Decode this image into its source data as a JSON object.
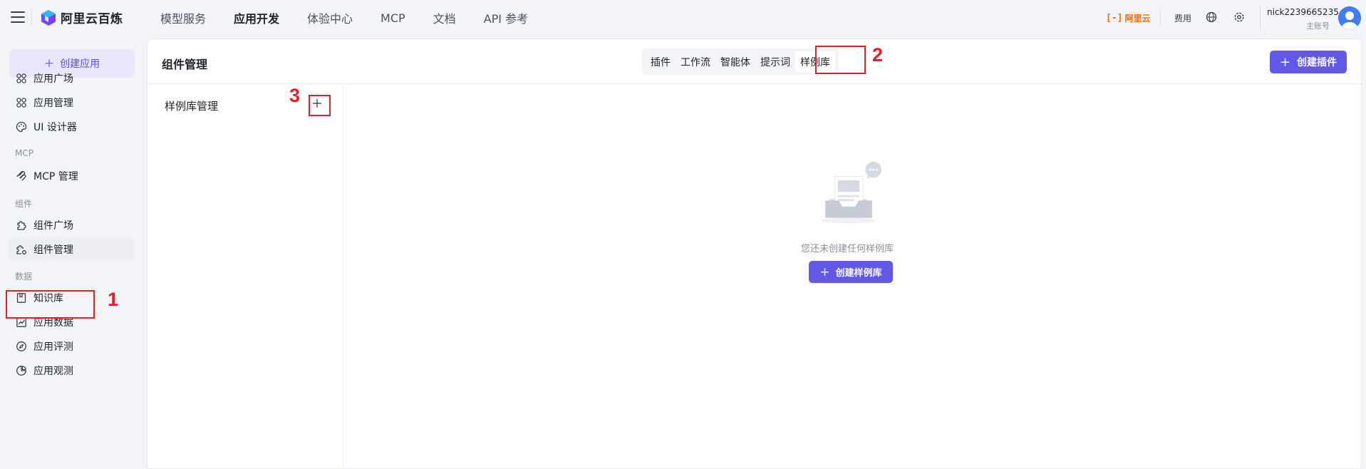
{
  "app": {
    "logo_text": "阿里云百炼"
  },
  "topnav": {
    "items": [
      {
        "label": "模型服务",
        "active": false
      },
      {
        "label": "应用开发",
        "active": true
      },
      {
        "label": "体验中心",
        "active": false
      },
      {
        "label": "MCP",
        "active": false
      },
      {
        "label": "文档",
        "active": false
      },
      {
        "label": "API 参考",
        "active": false
      }
    ],
    "aliyun_label": "阿里云",
    "cost_label": "费用",
    "user_name": "nick2239665235",
    "user_role": "主账号"
  },
  "sidebar": {
    "create_label": "创建应用",
    "items": [
      {
        "label": "应用广场",
        "icon": "apps-icon"
      },
      {
        "label": "应用管理",
        "icon": "apps-icon"
      },
      {
        "label": "UI 设计器",
        "icon": "palette-icon"
      }
    ],
    "sections": [
      {
        "title": "MCP",
        "items": [
          {
            "label": "MCP 管理",
            "icon": "mcp-icon"
          }
        ]
      },
      {
        "title": "组件",
        "items": [
          {
            "label": "组件广场",
            "icon": "puzzle-icon"
          },
          {
            "label": "组件管理",
            "icon": "puzzle-gear-icon",
            "active": true
          }
        ]
      },
      {
        "title": "数据",
        "items": [
          {
            "label": "知识库",
            "icon": "book-icon"
          },
          {
            "label": "应用数据",
            "icon": "chart-icon"
          },
          {
            "label": "应用评测",
            "icon": "compass-icon"
          },
          {
            "label": "应用观测",
            "icon": "pie-icon"
          }
        ]
      }
    ]
  },
  "main": {
    "title": "组件管理",
    "tabs": [
      {
        "label": "插件"
      },
      {
        "label": "工作流"
      },
      {
        "label": "智能体"
      },
      {
        "label": "提示词"
      },
      {
        "label": "样例库",
        "active": true
      }
    ],
    "create_plugin_label": "创建插件",
    "library_title": "样例库管理",
    "empty_text": "您还未创建任何样例库",
    "create_library_label": "创建样例库"
  },
  "annotations": [
    "1",
    "2",
    "3"
  ],
  "colors": {
    "accent": "#6159e6",
    "annotation": "#e41f27",
    "aliyun_orange": "#ff6a00"
  }
}
